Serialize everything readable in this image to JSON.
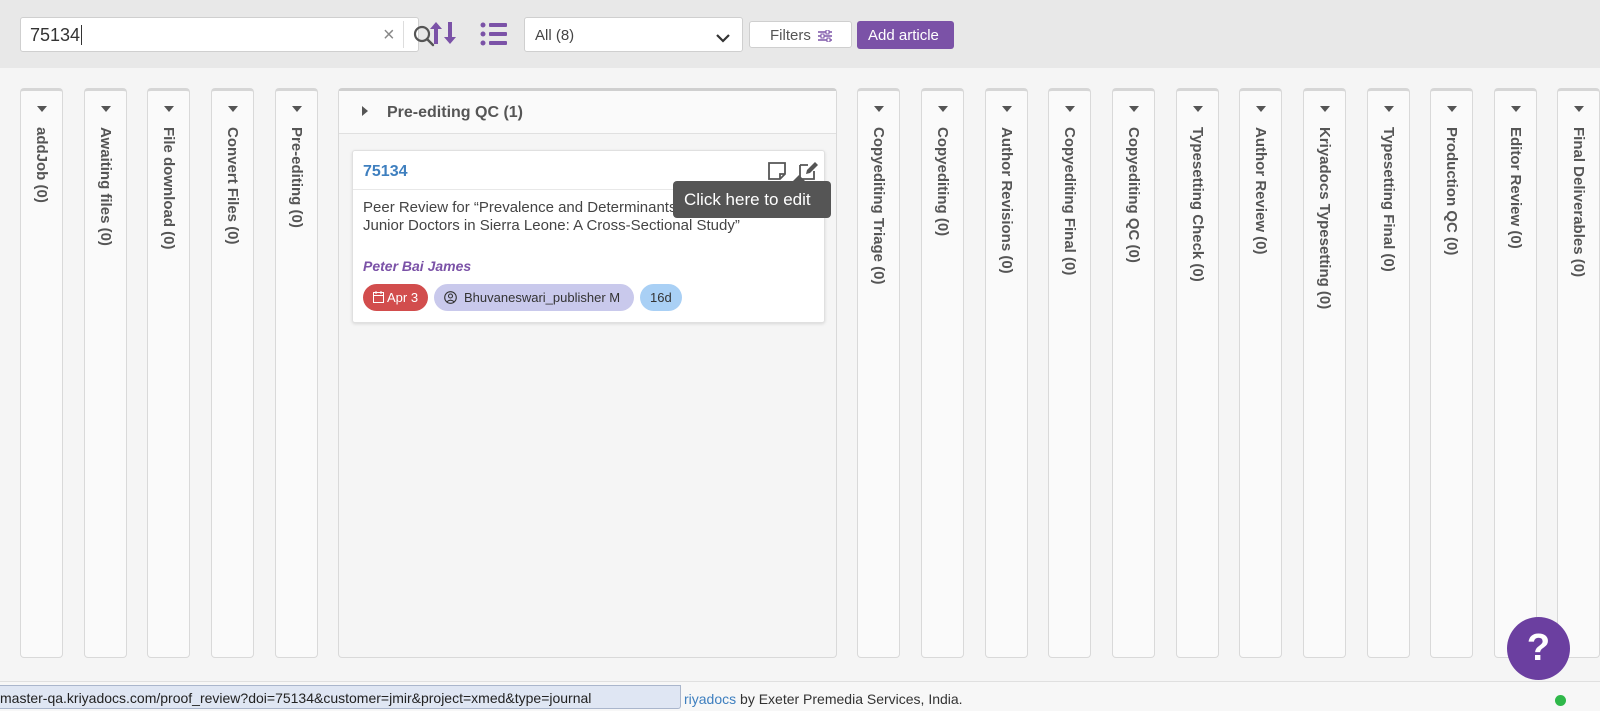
{
  "toolbar": {
    "search_value": "75134",
    "clear_glyph": "×",
    "filter_select": "All  (8)",
    "filters_label": "Filters",
    "add_article_label": "Add article",
    "icons": [
      "search-icon",
      "sort-icon",
      "list-view-icon",
      "chevron-down-icon",
      "sliders-icon"
    ]
  },
  "columns_left": [
    {
      "label": "addJob (0)"
    },
    {
      "label": "Awaiting files (0)"
    },
    {
      "label": "File download (0)"
    },
    {
      "label": "Convert Files (0)"
    },
    {
      "label": "Pre-editing (0)"
    }
  ],
  "expanded_column": {
    "title": "Pre-editing QC (1)",
    "card": {
      "doi": "75134",
      "title": "Peer Review for “Prevalence and Determinants of Bullying Among Junior Doctors in Sierra Leone: A Cross-Sectional Study”",
      "author": "Peter Bai James",
      "date_chip": "Apr 3",
      "user_chip": "Bhuvaneswari_publisher M",
      "days_chip": "16d"
    }
  },
  "columns_right": [
    {
      "label": "Copyediting Triage (0)"
    },
    {
      "label": "Copyediting (0)"
    },
    {
      "label": "Author Revisions (0)"
    },
    {
      "label": "Copyediting Final (0)"
    },
    {
      "label": "Copyediting QC (0)"
    },
    {
      "label": "Typesetting Check (0)"
    },
    {
      "label": "Author Review (0)"
    },
    {
      "label": "Kriyadocs Typesetting (0)"
    },
    {
      "label": "Typesetting Final (0)"
    },
    {
      "label": "Production QC (0)"
    },
    {
      "label": "Editor Review (0)"
    },
    {
      "label": "Final Deliverables (0)"
    }
  ],
  "tooltip": "Click here to edit",
  "help_glyph": "?",
  "footer": {
    "link_text": "riyadocs",
    "credit_rest": " by Exeter Premedia Services, India."
  },
  "status_url": "master-qa.kriyadocs.com/proof_review?doi=75134&customer=jmir&project=xmed&type=journal",
  "colors": {
    "accent": "#7b52a7",
    "doi_link": "#3e7fbf",
    "date_chip": "#d24d4d",
    "user_chip": "#c9c9ec",
    "days_chip": "#a9d0f5",
    "online_dot": "#2fb84a"
  }
}
